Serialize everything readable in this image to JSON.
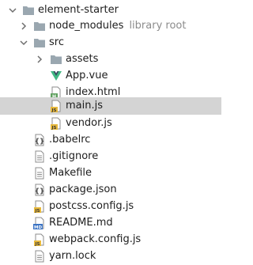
{
  "tree": {
    "root": {
      "name": "element-starter",
      "icon": "folder-icon"
    },
    "node_modules": {
      "name": "node_modules",
      "hint": "library root",
      "icon": "folder-icon"
    },
    "src": {
      "name": "src",
      "icon": "folder-icon"
    },
    "assets": {
      "name": "assets",
      "icon": "folder-icon"
    },
    "app_vue": {
      "name": "App.vue",
      "icon": "vue-file-icon"
    },
    "index_html": {
      "name": "index.html",
      "icon": "html-file-icon"
    },
    "main_js": {
      "name": "main.js",
      "icon": "js-file-icon"
    },
    "vendor_js": {
      "name": "vendor.js",
      "icon": "js-file-icon"
    },
    "babelrc": {
      "name": ".babelrc",
      "icon": "config-file-icon"
    },
    "gitignore": {
      "name": ".gitignore",
      "icon": "text-file-icon"
    },
    "makefile": {
      "name": "Makefile",
      "icon": "text-file-icon"
    },
    "package_json": {
      "name": "package.json",
      "icon": "config-file-icon"
    },
    "postcss_config": {
      "name": "postcss.config.js",
      "icon": "js-file-icon"
    },
    "readme": {
      "name": "README.md",
      "icon": "markdown-file-icon"
    },
    "webpack_config": {
      "name": "webpack.config.js",
      "icon": "js-file-icon"
    },
    "yarn_lock": {
      "name": "yarn.lock",
      "icon": "text-file-icon"
    }
  },
  "colors": {
    "folder": "#9aa7b0",
    "vue_green": "#41b883",
    "html_green": "#5fa05f",
    "js_yellow": "#e8b93c",
    "md_blue": "#3c74c4",
    "selection": "#d4d4d4",
    "hint": "#8c8c8c"
  }
}
